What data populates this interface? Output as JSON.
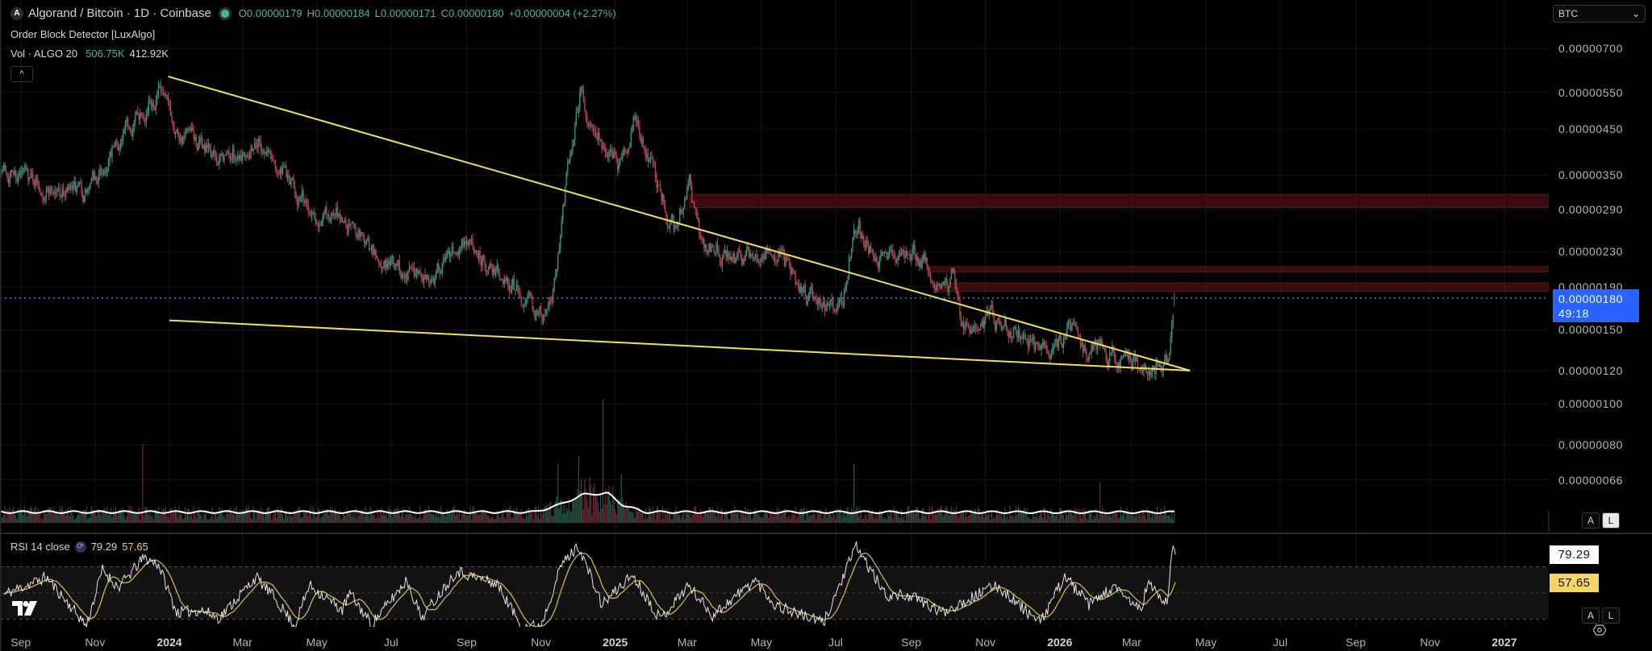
{
  "header": {
    "symbol_title": "Algorand / Bitcoin · 1D · Coinbase",
    "logo_letter": "A",
    "ohlc": {
      "o_label": "O",
      "o": "0.00000179",
      "h_label": "H",
      "h": "0.00000184",
      "l_label": "L",
      "l": "0.00000171",
      "c_label": "C",
      "c": "0.00000180",
      "change": "+0.00000004 (+2.27%)"
    },
    "indicator_1": "Order Block Detector [LuxAlgo]",
    "volume_label": "Vol · ALGO 20",
    "volume_value": "506.75K",
    "volume_ma_value": "412.92K",
    "collapse_glyph": "^"
  },
  "price_axis": {
    "currency_select": "BTC",
    "currency_caret": "⌄",
    "labels": [
      "0.00000700",
      "0.00000550",
      "0.00000450",
      "0.00000350",
      "0.00000290",
      "0.00000230",
      "0.00000190",
      "0.00000150",
      "0.00000120",
      "0.00000100",
      "0.00000080",
      "0.00000066"
    ],
    "current_price": "0.00000180",
    "countdown": "49:18",
    "auto_button": "A",
    "log_button": "L"
  },
  "rsi": {
    "label": "RSI 14 close",
    "value": "79.29",
    "ma_value": "57.65",
    "auto_button": "A",
    "log_button": "L"
  },
  "time_axis": [
    {
      "label": "Sep",
      "year": false
    },
    {
      "label": "Nov",
      "year": false
    },
    {
      "label": "2024",
      "year": true
    },
    {
      "label": "Mar",
      "year": false
    },
    {
      "label": "May",
      "year": false
    },
    {
      "label": "Jul",
      "year": false
    },
    {
      "label": "Sep",
      "year": false
    },
    {
      "label": "Nov",
      "year": false
    },
    {
      "label": "2025",
      "year": true
    },
    {
      "label": "Mar",
      "year": false
    },
    {
      "label": "May",
      "year": false
    },
    {
      "label": "Jul",
      "year": false
    },
    {
      "label": "Sep",
      "year": false
    },
    {
      "label": "Nov",
      "year": false
    },
    {
      "label": "2026",
      "year": true
    },
    {
      "label": "Mar",
      "year": false
    },
    {
      "label": "May",
      "year": false
    },
    {
      "label": "Jul",
      "year": false
    },
    {
      "label": "Sep",
      "year": false
    },
    {
      "label": "Nov",
      "year": false
    },
    {
      "label": "2027",
      "year": true
    }
  ],
  "colors": {
    "up": "#3a8f80",
    "down": "#b04550",
    "trendline": "#f2df5b",
    "order_block": "#6b1414",
    "current_price": "#2962ff",
    "rsi_line": "#e6e6e6",
    "rsi_ma": "#c9b458",
    "volume_ma": "#ffffff"
  },
  "chart_data": {
    "type": "candlestick",
    "title": "Algorand / Bitcoin · 1D · Coinbase",
    "price_unit": "1e-8 BTC (satoshi)",
    "time_unit": "days since 2024-01-01",
    "y_scale": "log",
    "ylim": [
      60,
      800
    ],
    "time_ticks_days": [
      -122,
      -61,
      0,
      60,
      121,
      182,
      244,
      305,
      366,
      425,
      486,
      547,
      609,
      670,
      731,
      790,
      851,
      912,
      974,
      1035,
      1096
    ],
    "price_path": [
      [
        -139,
        367
      ],
      [
        -70,
        305
      ],
      [
        -53,
        363
      ],
      [
        -22,
        513
      ],
      [
        -9,
        559
      ],
      [
        -1,
        484
      ],
      [
        12,
        431
      ],
      [
        42,
        374
      ],
      [
        73,
        431
      ],
      [
        99,
        333
      ],
      [
        112,
        297
      ],
      [
        155,
        264
      ],
      [
        172,
        216
      ],
      [
        216,
        204
      ],
      [
        241,
        243
      ],
      [
        267,
        216
      ],
      [
        293,
        172
      ],
      [
        306,
        162
      ],
      [
        315,
        187
      ],
      [
        324,
        314
      ],
      [
        332,
        457
      ],
      [
        338,
        559
      ],
      [
        345,
        484
      ],
      [
        358,
        407
      ],
      [
        371,
        363
      ],
      [
        382,
        484
      ],
      [
        401,
        333
      ],
      [
        414,
        264
      ],
      [
        427,
        333
      ],
      [
        436,
        243
      ],
      [
        466,
        222
      ],
      [
        484,
        229
      ],
      [
        501,
        229
      ],
      [
        518,
        187
      ],
      [
        535,
        167
      ],
      [
        553,
        172
      ],
      [
        560,
        243
      ],
      [
        566,
        264
      ],
      [
        579,
        222
      ],
      [
        605,
        229
      ],
      [
        631,
        204
      ],
      [
        644,
        193
      ],
      [
        650,
        153
      ],
      [
        674,
        162
      ],
      [
        691,
        149
      ],
      [
        717,
        129
      ],
      [
        739,
        149
      ],
      [
        760,
        132
      ],
      [
        795,
        125
      ],
      [
        812,
        125
      ],
      [
        821,
        129
      ],
      [
        825,
        180
      ]
    ],
    "last": {
      "open": 179,
      "high": 184,
      "low": 171,
      "close": 180
    },
    "trendlines": [
      {
        "name": "upper-trendline",
        "from": [
          -1,
          600
        ],
        "to": [
          838,
          120
        ]
      },
      {
        "name": "lower-trendline",
        "from": [
          0,
          158
        ],
        "to": [
          838,
          120
        ]
      }
    ],
    "order_blocks": [
      {
        "start": 427,
        "top": 315,
        "bottom": 293
      },
      {
        "start": 624,
        "top": 212,
        "bottom": 206
      },
      {
        "start": 632,
        "top": 194,
        "bottom": 185
      }
    ],
    "volume_ma_k": [
      [
        -139,
        420
      ],
      [
        300,
        420
      ],
      [
        320,
        700
      ],
      [
        340,
        1100
      ],
      [
        360,
        1150
      ],
      [
        372,
        700
      ],
      [
        390,
        420
      ],
      [
        825,
        412.92
      ]
    ],
    "volume_spikes_k": [
      [
        -22,
        3060
      ],
      [
        319,
        2300
      ],
      [
        336,
        2600
      ],
      [
        356,
        4800
      ],
      [
        371,
        1900
      ],
      [
        562,
        2300
      ],
      [
        764,
        1600
      ],
      [
        825,
        506.75
      ]
    ],
    "rsi": {
      "period": 14,
      "levels": [
        70,
        50,
        30
      ],
      "ylim": [
        0,
        100
      ],
      "path": [
        [
          -136,
          49
        ],
        [
          -101,
          62
        ],
        [
          -68,
          25
        ],
        [
          -55,
          68
        ],
        [
          -42,
          54
        ],
        [
          -21,
          77
        ],
        [
          -9,
          72
        ],
        [
          6,
          35
        ],
        [
          26,
          37
        ],
        [
          41,
          31
        ],
        [
          71,
          62
        ],
        [
          85,
          48
        ],
        [
          103,
          25
        ],
        [
          115,
          56
        ],
        [
          142,
          37
        ],
        [
          148,
          50
        ],
        [
          166,
          26
        ],
        [
          195,
          60
        ],
        [
          207,
          31
        ],
        [
          236,
          67
        ],
        [
          251,
          62
        ],
        [
          269,
          57
        ],
        [
          289,
          25
        ],
        [
          305,
          25
        ],
        [
          322,
          72
        ],
        [
          336,
          86
        ],
        [
          355,
          41
        ],
        [
          380,
          64
        ],
        [
          403,
          30
        ],
        [
          426,
          56
        ],
        [
          446,
          33
        ],
        [
          481,
          60
        ],
        [
          497,
          41
        ],
        [
          537,
          27
        ],
        [
          564,
          86
        ],
        [
          588,
          48
        ],
        [
          608,
          48
        ],
        [
          634,
          35
        ],
        [
          679,
          56
        ],
        [
          715,
          27
        ],
        [
          735,
          63
        ],
        [
          755,
          41
        ],
        [
          775,
          54
        ],
        [
          798,
          37
        ],
        [
          803,
          58
        ],
        [
          819,
          41
        ],
        [
          824,
          88
        ],
        [
          826,
          79.29
        ]
      ]
    }
  }
}
